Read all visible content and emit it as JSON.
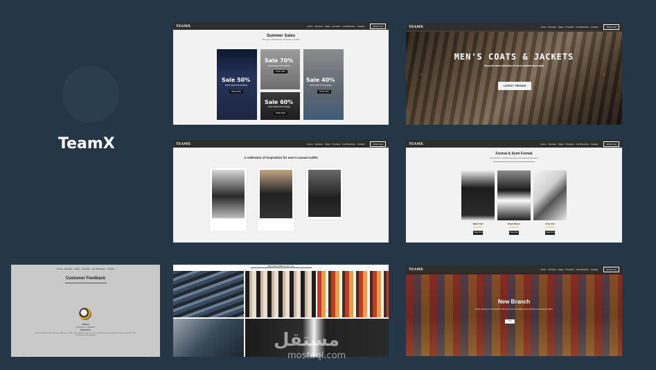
{
  "brand": {
    "name": "TeamX"
  },
  "nav": {
    "logo": "TEAMX",
    "items": [
      "Home",
      "Services",
      "Sales",
      "Products",
      "Our Branches",
      "Contact"
    ],
    "cta": "what's new"
  },
  "shot_sales": {
    "title": "Summer Sales",
    "subtitle": "Don't go for 1000 Solutions on Summer or Outfits",
    "cards": [
      {
        "label": "Sale 50%",
        "note": "DON'T MISS THIS CHANCE",
        "button": "SHOP NOW",
        "color": "#1b2235"
      },
      {
        "label": "Sale 70%",
        "note": "DON'T MISS THIS CHANCE",
        "button": "SHOP NOW",
        "color": "#8a8a8a"
      },
      {
        "label": "Sale 40%",
        "note": "DON'T MISS THIS CHANCE",
        "button": "SHOP NOW",
        "color": "#7b7b7b"
      },
      {
        "label": "Sale 60%",
        "note": "DON'T MISS THIS CHANCE",
        "button": "SHOP NOW",
        "color": "#2c2c2c"
      }
    ]
  },
  "shot_hero": {
    "title": "MEN'S COATS & JACKETS",
    "subtitle": "Shop the best collection of men's jackets and coats",
    "button": "LATEST TRENDS"
  },
  "shot_inspiration": {
    "title": "A collection of inspiration for men's casual outfits"
  },
  "shot_formal": {
    "title": "Formal & Semi Formal",
    "subtitle": "Only the finest - look the best chip, at the highest & best brand",
    "products": [
      {
        "name": "Black Suit",
        "stars": "★★★★★",
        "button": "Shop Now"
      },
      {
        "name": "Black Blazer",
        "stars": "★★★★★",
        "button": "Shop Now"
      },
      {
        "name": "Gray Suit",
        "stars": "★★★★★",
        "button": "Shop Now"
      }
    ]
  },
  "shot_feedback": {
    "title": "Customer Feedback",
    "name": "Ahmed",
    "role": "Art Director — Networks",
    "company": "Brand Shop",
    "text": "Lorem ipsum dolor sit amet consectetur adipisicing elit. Nulla, ratione impedit est unde rerum et sint, incidunt sequi autem voluptatem ad ratione in eius natus. Libero quibusdam quia odio repellendus."
  },
  "shot_gallery": {
    "title": "Recommendations for You"
  },
  "shot_branch": {
    "title": "New Branch",
    "subtitle": "We are opening our new branch in the heart of the old market, come and visit us and enjoy the offers",
    "button": "Visit"
  },
  "watermark": {
    "arabic": "مستقل",
    "latin": "mostaql.com"
  }
}
